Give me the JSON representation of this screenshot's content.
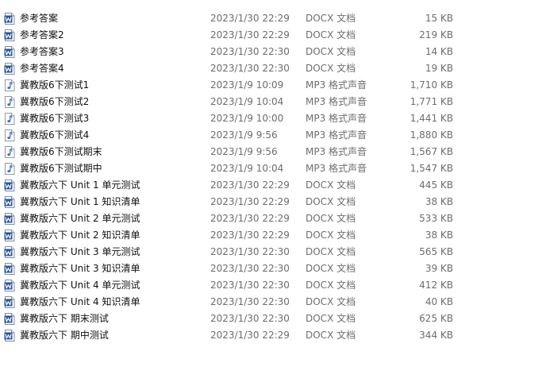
{
  "files": [
    {
      "name": "参考答案",
      "date": "2023/1/30 22:29",
      "type": "DOCX 文档",
      "size": "15 KB",
      "icon": "word-document-icon"
    },
    {
      "name": "参考答案2",
      "date": "2023/1/30 22:29",
      "type": "DOCX 文档",
      "size": "219 KB",
      "icon": "word-document-icon"
    },
    {
      "name": "参考答案3",
      "date": "2023/1/30 22:30",
      "type": "DOCX 文档",
      "size": "14 KB",
      "icon": "word-document-icon"
    },
    {
      "name": "参考答案4",
      "date": "2023/1/30 22:30",
      "type": "DOCX 文档",
      "size": "19 KB",
      "icon": "word-document-icon"
    },
    {
      "name": "冀教版6下测试1",
      "date": "2023/1/9 10:09",
      "type": "MP3 格式声音",
      "size": "1,710 KB",
      "icon": "audio-file-icon"
    },
    {
      "name": "冀教版6下测试2",
      "date": "2023/1/9 10:04",
      "type": "MP3 格式声音",
      "size": "1,771 KB",
      "icon": "audio-file-icon"
    },
    {
      "name": "冀教版6下测试3",
      "date": "2023/1/9 10:00",
      "type": "MP3 格式声音",
      "size": "1,441 KB",
      "icon": "audio-file-icon"
    },
    {
      "name": "冀教版6下测试4",
      "date": "2023/1/9 9:56",
      "type": "MP3 格式声音",
      "size": "1,880 KB",
      "icon": "audio-file-icon"
    },
    {
      "name": "冀教版6下测试期末",
      "date": "2023/1/9 9:56",
      "type": "MP3 格式声音",
      "size": "1,567 KB",
      "icon": "audio-file-icon"
    },
    {
      "name": "冀教版6下测试期中",
      "date": "2023/1/9 10:04",
      "type": "MP3 格式声音",
      "size": "1,547 KB",
      "icon": "audio-file-icon"
    },
    {
      "name": "冀教版六下 Unit 1 单元测试",
      "date": "2023/1/30 22:29",
      "type": "DOCX 文档",
      "size": "445 KB",
      "icon": "word-document-icon"
    },
    {
      "name": "冀教版六下 Unit 1 知识清单",
      "date": "2023/1/30 22:29",
      "type": "DOCX 文档",
      "size": "38 KB",
      "icon": "word-document-icon"
    },
    {
      "name": "冀教版六下 Unit 2 单元测试",
      "date": "2023/1/30 22:29",
      "type": "DOCX 文档",
      "size": "533 KB",
      "icon": "word-document-icon"
    },
    {
      "name": "冀教版六下 Unit 2 知识清单",
      "date": "2023/1/30 22:29",
      "type": "DOCX 文档",
      "size": "38 KB",
      "icon": "word-document-icon"
    },
    {
      "name": "冀教版六下 Unit 3 单元测试",
      "date": "2023/1/30 22:30",
      "type": "DOCX 文档",
      "size": "565 KB",
      "icon": "word-document-icon"
    },
    {
      "name": "冀教版六下 Unit 3 知识清单",
      "date": "2023/1/30 22:30",
      "type": "DOCX 文档",
      "size": "39 KB",
      "icon": "word-document-icon"
    },
    {
      "name": "冀教版六下 Unit 4 单元测试",
      "date": "2023/1/30 22:30",
      "type": "DOCX 文档",
      "size": "412 KB",
      "icon": "word-document-icon"
    },
    {
      "name": "冀教版六下 Unit 4 知识清单",
      "date": "2023/1/30 22:30",
      "type": "DOCX 文档",
      "size": "40 KB",
      "icon": "word-document-icon"
    },
    {
      "name": "冀教版六下 期末测试",
      "date": "2023/1/30 22:30",
      "type": "DOCX 文档",
      "size": "625 KB",
      "icon": "word-document-icon"
    },
    {
      "name": "冀教版六下 期中测试",
      "date": "2023/1/30 22:29",
      "type": "DOCX 文档",
      "size": "344 KB",
      "icon": "word-document-icon"
    }
  ],
  "colors": {
    "word_icon": "#2b5797",
    "audio_icon": "#3a6fc4",
    "meta_text": "#6d6d6d"
  }
}
